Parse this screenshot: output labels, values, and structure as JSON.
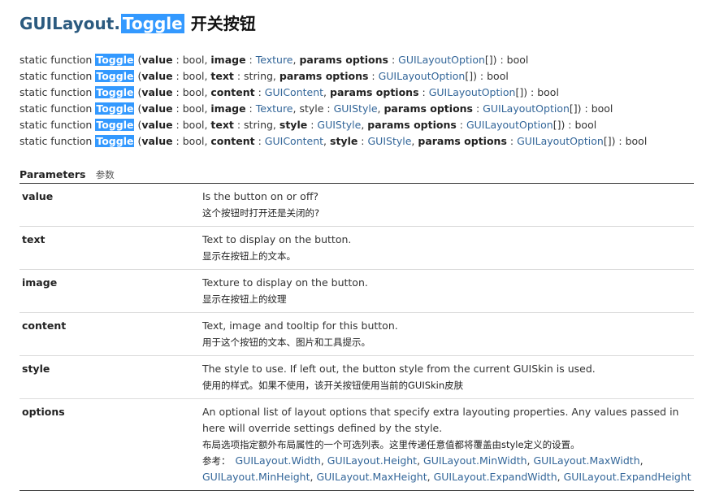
{
  "header": {
    "class_name": "GUILayout",
    "dot": ".",
    "method_name": "Toggle",
    "title_cn": "开关按钮"
  },
  "signatures": [
    [
      {
        "t": "text",
        "v": "static function "
      },
      {
        "t": "fn",
        "v": "Toggle"
      },
      {
        "t": "text",
        "v": " ("
      },
      {
        "t": "b",
        "v": "value"
      },
      {
        "t": "text",
        "v": " : bool, "
      },
      {
        "t": "b",
        "v": "image"
      },
      {
        "t": "text",
        "v": " : "
      },
      {
        "t": "ty",
        "v": "Texture"
      },
      {
        "t": "text",
        "v": ", "
      },
      {
        "t": "b",
        "v": "params options"
      },
      {
        "t": "text",
        "v": " : "
      },
      {
        "t": "ty",
        "v": "GUILayoutOption"
      },
      {
        "t": "text",
        "v": "[]) : bool"
      }
    ],
    [
      {
        "t": "text",
        "v": "static function "
      },
      {
        "t": "fn",
        "v": "Toggle"
      },
      {
        "t": "text",
        "v": " ("
      },
      {
        "t": "b",
        "v": "value"
      },
      {
        "t": "text",
        "v": " : bool, "
      },
      {
        "t": "b",
        "v": "text"
      },
      {
        "t": "text",
        "v": " : string, "
      },
      {
        "t": "b",
        "v": "params options"
      },
      {
        "t": "text",
        "v": " : "
      },
      {
        "t": "ty",
        "v": "GUILayoutOption"
      },
      {
        "t": "text",
        "v": "[]) : bool"
      }
    ],
    [
      {
        "t": "text",
        "v": "static function "
      },
      {
        "t": "fn",
        "v": "Toggle"
      },
      {
        "t": "text",
        "v": " ("
      },
      {
        "t": "b",
        "v": "value"
      },
      {
        "t": "text",
        "v": " : bool, "
      },
      {
        "t": "b",
        "v": "content"
      },
      {
        "t": "text",
        "v": " : "
      },
      {
        "t": "ty",
        "v": "GUIContent"
      },
      {
        "t": "text",
        "v": ", "
      },
      {
        "t": "b",
        "v": "params options"
      },
      {
        "t": "text",
        "v": " : "
      },
      {
        "t": "ty",
        "v": "GUILayoutOption"
      },
      {
        "t": "text",
        "v": "[]) : bool"
      }
    ],
    [
      {
        "t": "text",
        "v": "static function "
      },
      {
        "t": "fn",
        "v": "Toggle"
      },
      {
        "t": "text",
        "v": " ("
      },
      {
        "t": "b",
        "v": "value"
      },
      {
        "t": "text",
        "v": " : bool, "
      },
      {
        "t": "b",
        "v": "image"
      },
      {
        "t": "text",
        "v": " : "
      },
      {
        "t": "ty",
        "v": "Texture"
      },
      {
        "t": "text",
        "v": ", style : "
      },
      {
        "t": "ty",
        "v": "GUIStyle"
      },
      {
        "t": "text",
        "v": ", "
      },
      {
        "t": "b",
        "v": "params options"
      },
      {
        "t": "text",
        "v": " : "
      },
      {
        "t": "ty",
        "v": "GUILayoutOption"
      },
      {
        "t": "text",
        "v": "[]) : bool"
      }
    ],
    [
      {
        "t": "text",
        "v": "static function "
      },
      {
        "t": "fn",
        "v": "Toggle"
      },
      {
        "t": "text",
        "v": " ("
      },
      {
        "t": "b",
        "v": "value"
      },
      {
        "t": "text",
        "v": " : bool, "
      },
      {
        "t": "b",
        "v": "text"
      },
      {
        "t": "text",
        "v": " : string, "
      },
      {
        "t": "b",
        "v": "style"
      },
      {
        "t": "text",
        "v": " : "
      },
      {
        "t": "ty",
        "v": "GUIStyle"
      },
      {
        "t": "text",
        "v": ", "
      },
      {
        "t": "b",
        "v": "params options"
      },
      {
        "t": "text",
        "v": " : "
      },
      {
        "t": "ty",
        "v": "GUILayoutOption"
      },
      {
        "t": "text",
        "v": "[]) : bool"
      }
    ],
    [
      {
        "t": "text",
        "v": "static function "
      },
      {
        "t": "fn",
        "v": "Toggle"
      },
      {
        "t": "text",
        "v": " ("
      },
      {
        "t": "b",
        "v": "value"
      },
      {
        "t": "text",
        "v": " : bool, "
      },
      {
        "t": "b",
        "v": "content"
      },
      {
        "t": "text",
        "v": " : "
      },
      {
        "t": "ty",
        "v": "GUIContent"
      },
      {
        "t": "text",
        "v": ", "
      },
      {
        "t": "b",
        "v": "style"
      },
      {
        "t": "text",
        "v": " : "
      },
      {
        "t": "ty",
        "v": "GUIStyle"
      },
      {
        "t": "text",
        "v": ", "
      },
      {
        "t": "b",
        "v": "params options"
      },
      {
        "t": "text",
        "v": " : "
      },
      {
        "t": "ty",
        "v": "GUILayoutOption"
      },
      {
        "t": "text",
        "v": "[]) : bool"
      }
    ]
  ],
  "parameters": {
    "heading": "Parameters",
    "heading_cn": "参数",
    "rows": [
      {
        "name": "value",
        "en": "Is the button on or off?",
        "cn": "这个按钮时打开还是关闭的?"
      },
      {
        "name": "text",
        "en": "Text to display on the button.",
        "cn": "显示在按钮上的文本。"
      },
      {
        "name": "image",
        "en": "Texture to display on the button.",
        "cn": "显示在按钮上的纹理"
      },
      {
        "name": "content",
        "en": "Text, image and tooltip for this button.",
        "cn": "用于这个按钮的文本、图片和工具提示。"
      },
      {
        "name": "style",
        "en": "The style to use. If left out, the button style from the current GUISkin is used.",
        "cn": "使用的样式。如果不使用，该开关按钮使用当前的GUISkin皮肤"
      },
      {
        "name": "options",
        "en": "An optional list of layout options that specify extra layouting properties. Any values passed in here will override settings defined by the style.",
        "cn": "布局选项指定额外布局属性的一个可选列表。这里传递任意值都将覆盖由style定义的设置。"
      }
    ],
    "see_also_label": "参考：",
    "see_also": [
      "GUILayout.Width",
      "GUILayout.Height",
      "GUILayout.MinWidth",
      "GUILayout.MaxWidth",
      "GUILayout.MinHeight",
      "GUILayout.MaxHeight",
      "GUILayout.ExpandWidth",
      "GUILayout.ExpandHeight"
    ]
  },
  "colors": {
    "highlight": "#3399ff",
    "title": "#2b5a7f",
    "link": "#336699"
  }
}
